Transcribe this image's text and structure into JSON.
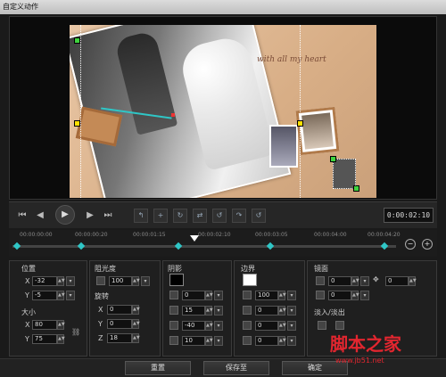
{
  "window": {
    "title": "自定义动作"
  },
  "preview": {
    "script_text": "with all my heart"
  },
  "transport": {
    "icons": [
      "skip-start-icon",
      "step-back-icon",
      "play-icon",
      "step-forward-icon",
      "skip-end-icon"
    ],
    "timecode": "0:00:02:10"
  },
  "timeline": {
    "ruler_labels": [
      "00:00:00:00",
      "00:00:00:20",
      "00:00:01:15",
      "00:00:02:10",
      "00:00:03:05",
      "00:00:04:00",
      "00:00:04:20"
    ],
    "zoom_out": "−",
    "zoom_in": "+"
  },
  "position": {
    "title": "位置",
    "x_label": "X",
    "x_value": "-32",
    "y_label": "Y",
    "y_value": "-5"
  },
  "size": {
    "title": "大小",
    "x_label": "X",
    "x_value": "80",
    "y_label": "Y",
    "y_value": "75"
  },
  "opacity": {
    "title": "阻光度",
    "value": "100"
  },
  "rotation": {
    "title": "旋转",
    "x_label": "X",
    "x_value": "0",
    "y_label": "Y",
    "y_value": "0",
    "z_label": "Z",
    "z_value": "18"
  },
  "shadow": {
    "title": "阴影",
    "color": "#000000",
    "v1": "0",
    "v2": "15",
    "v3": "-40",
    "v4": "10"
  },
  "border": {
    "title": "边界",
    "color": "#ffffff",
    "v1": "100",
    "v2": "0",
    "v3": "0",
    "v4": "0"
  },
  "mirror": {
    "title": "镜面",
    "v1": "0",
    "v2": "0",
    "v3": "0"
  },
  "fade": {
    "title": "淡入/淡出"
  },
  "footer": {
    "reset": "重置",
    "save_as": "保存至",
    "ok": "确定"
  },
  "watermark": {
    "text": "脚本之家",
    "url": "www.jb51.net"
  }
}
